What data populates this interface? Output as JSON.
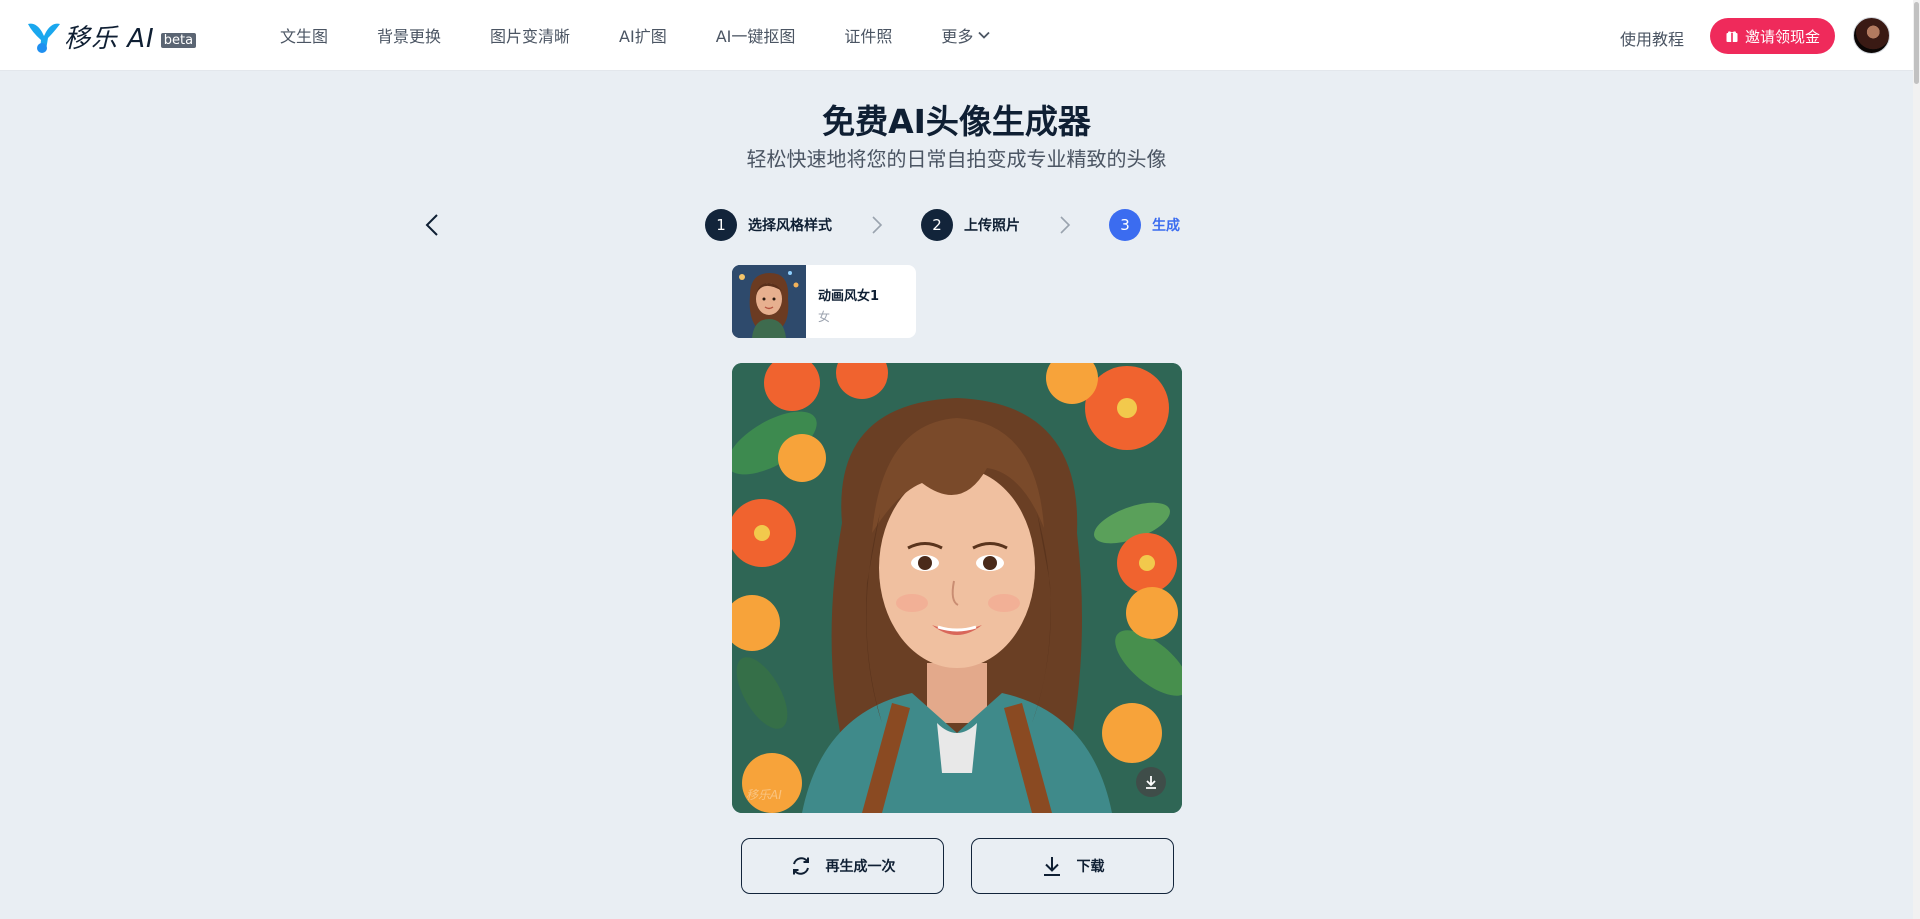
{
  "brand": {
    "name": "移乐 AI",
    "badge": "beta"
  },
  "nav": {
    "items": [
      "文生图",
      "背景更换",
      "图片变清晰",
      "AI扩图",
      "AI一键抠图",
      "证件照"
    ],
    "more": "更多"
  },
  "header": {
    "tutorial": "使用教程",
    "invite": "邀请领现金"
  },
  "page": {
    "title": "免费AI头像生成器",
    "subtitle": "轻松快速地将您的日常自拍变成专业精致的头像"
  },
  "steps": [
    {
      "num": "1",
      "label": "选择风格样式"
    },
    {
      "num": "2",
      "label": "上传照片"
    },
    {
      "num": "3",
      "label": "生成"
    }
  ],
  "active_step": 3,
  "style": {
    "name": "动画风女1",
    "gender": "女"
  },
  "result": {
    "watermark": "移乐AI"
  },
  "actions": {
    "regenerate": "再生成一次",
    "download": "下载"
  },
  "colors": {
    "accent": "#3b6cf0",
    "invite": "#ef2a5b",
    "dark": "#12243a",
    "bg": "#e9eef3"
  }
}
